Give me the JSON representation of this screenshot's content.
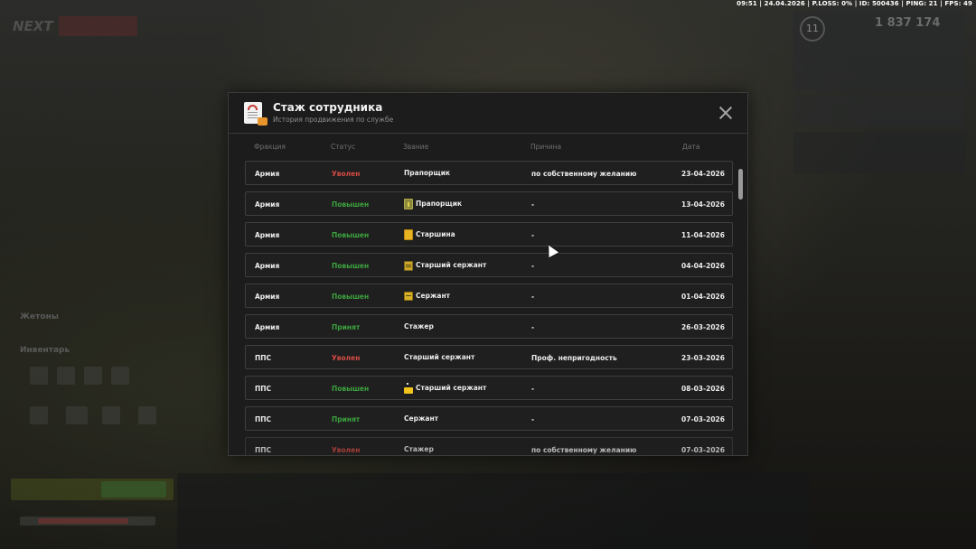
{
  "hud": {
    "status_line": "09:51 | 24.04.2026 | P.LOSS: 0% | ID: 500436 | PING: 21 | FPS: 49"
  },
  "background": {
    "logo_text": "NEXT",
    "server_label": "",
    "level": "11",
    "money": "1 837 174",
    "left_label_1": "Жетоны",
    "left_label_2": "Инвентарь"
  },
  "dialog": {
    "title": "Стаж сотрудника",
    "subtitle": "История продвижения по службе",
    "close_icon": "close-icon",
    "columns": {
      "fraction": "Фракция",
      "status": "Статус",
      "rank": "Звание",
      "reason": "Причина",
      "date": "Дата"
    },
    "rows": [
      {
        "fraction": "Армия",
        "status": "Уволен",
        "status_type": "fired",
        "rank": "Прапорщик",
        "rank_icon": "",
        "reason": "по собственному желанию",
        "date": "23-04-2026"
      },
      {
        "fraction": "Армия",
        "status": "Повышен",
        "status_type": "promoted",
        "rank": "Прапорщик",
        "rank_icon": "olive",
        "reason": "-",
        "date": "13-04-2026"
      },
      {
        "fraction": "Армия",
        "status": "Повышен",
        "status_type": "promoted",
        "rank": "Старшина",
        "rank_icon": "gold",
        "reason": "-",
        "date": "11-04-2026"
      },
      {
        "fraction": "Армия",
        "status": "Повышен",
        "status_type": "promoted",
        "rank": "Старший сержант",
        "rank_icon": "stripes",
        "reason": "-",
        "date": "04-04-2026"
      },
      {
        "fraction": "Армия",
        "status": "Повышен",
        "status_type": "promoted",
        "rank": "Сержант",
        "rank_icon": "sergeant",
        "reason": "-",
        "date": "01-04-2026"
      },
      {
        "fraction": "Армия",
        "status": "Принят",
        "status_type": "hired",
        "rank": "Стажер",
        "rank_icon": "",
        "reason": "-",
        "date": "26-03-2026"
      },
      {
        "fraction": "ППС",
        "status": "Уволен",
        "status_type": "fired",
        "rank": "Старший сержант",
        "rank_icon": "",
        "reason": "Проф. непригодность",
        "date": "23-03-2026"
      },
      {
        "fraction": "ППС",
        "status": "Повышен",
        "status_type": "promoted",
        "rank": "Старший сержант",
        "rank_icon": "pps",
        "reason": "-",
        "date": "08-03-2026"
      },
      {
        "fraction": "ППС",
        "status": "Принят",
        "status_type": "hired",
        "rank": "Сержант",
        "rank_icon": "",
        "reason": "-",
        "date": "07-03-2026"
      },
      {
        "fraction": "ППС",
        "status": "Уволен",
        "status_type": "fired",
        "rank": "Стажер",
        "rank_icon": "",
        "reason": "по собственному желанию",
        "date": "07-03-2026"
      }
    ]
  },
  "colors": {
    "fired": "#d24a43",
    "promoted": "#3ca33e",
    "dialog_bg": "#1c1c1c"
  }
}
